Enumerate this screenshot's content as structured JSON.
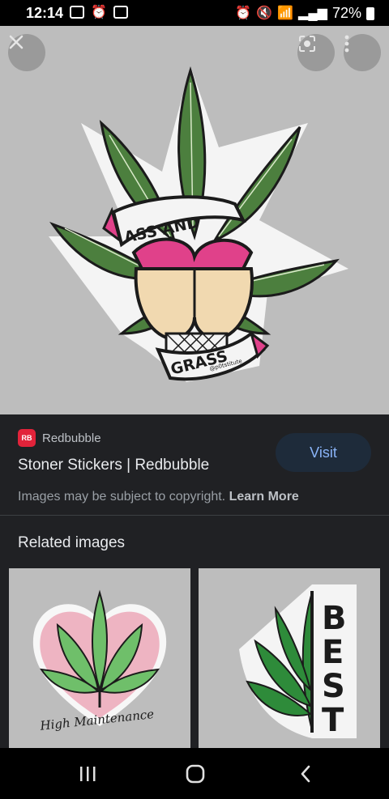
{
  "status_bar": {
    "time": "12:14",
    "battery": "72%",
    "left_icons": [
      "mail-icon",
      "alarm-app-icon",
      "gallery-icon"
    ],
    "right_icons": [
      "alarm-icon",
      "mute-icon",
      "wifi-icon",
      "signal-icon",
      "battery-icon"
    ]
  },
  "hero": {
    "sticker_text_top": "ASS AND",
    "sticker_text_bottom": "GRASS",
    "sticker_credit": "@p0tstitute",
    "buttons": [
      "close-icon",
      "lens-icon",
      "more-vert-icon"
    ]
  },
  "result": {
    "source": "Redbubble",
    "logo_text": "RB",
    "title": "Stoner Stickers | Redbubble",
    "visit_label": "Visit",
    "copyright_text": "Images may be subject to copyright.",
    "learn_more": "Learn More"
  },
  "related": {
    "title": "Related images",
    "items": [
      {
        "text": "High Maintenance"
      },
      {
        "text": "BEST"
      }
    ]
  },
  "colors": {
    "accent": "#8ab4f8",
    "leaf_green": "#4c7f3e",
    "pink": "#e0418a",
    "brand_red": "#e2233a"
  }
}
